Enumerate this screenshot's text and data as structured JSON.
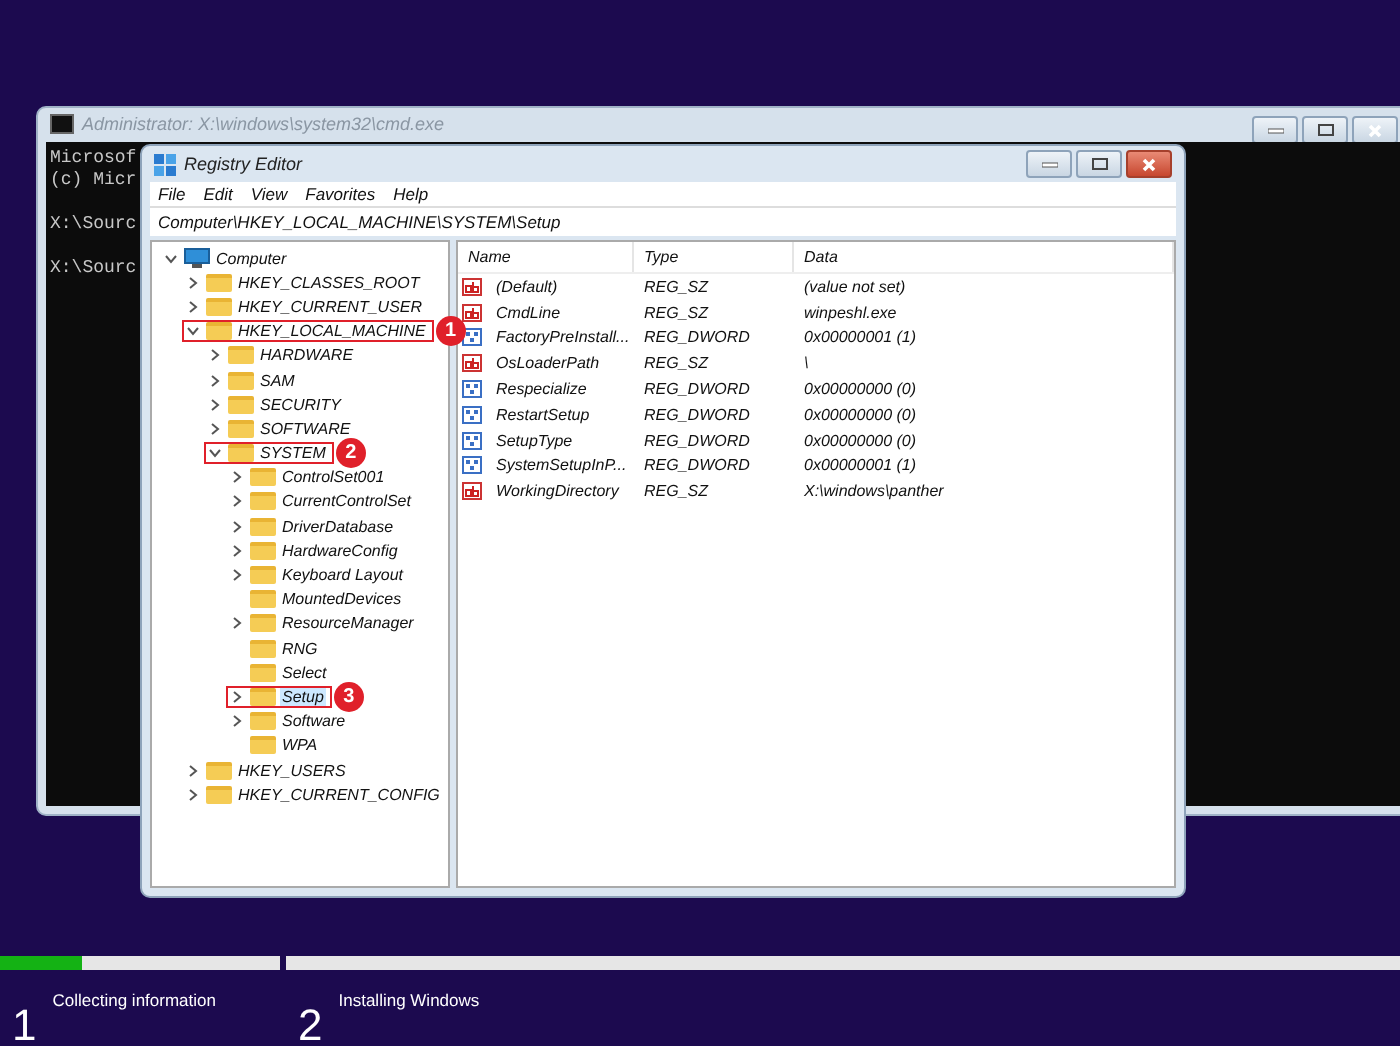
{
  "console": {
    "title": "Administrator: X:\\windows\\system32\\cmd.exe",
    "blocks": [
      [
        "Microsof",
        "(c) Micr"
      ],
      [
        "X:\\Sourc"
      ],
      [
        "X:\\Sourc"
      ]
    ]
  },
  "regedit": {
    "title": "Registry Editor",
    "menu": [
      "File",
      "Edit",
      "View",
      "Favorites",
      "Help"
    ],
    "address": "Computer\\HKEY_LOCAL_MACHINE\\SYSTEM\\Setup",
    "tree": [
      {
        "label": "Computer",
        "kind": "computer",
        "expanded": true,
        "selected": false,
        "children": [
          {
            "label": "HKEY_CLASSES_ROOT",
            "expanded": false,
            "selected": false
          },
          {
            "label": "HKEY_CURRENT_USER",
            "expanded": false,
            "selected": false
          },
          {
            "label": "HKEY_LOCAL_MACHINE",
            "expanded": true,
            "selected": false,
            "callout": "1",
            "children": [
              {
                "label": "HARDWARE",
                "expanded": false,
                "selected": false
              },
              {
                "label": "SAM",
                "expanded": false,
                "selected": false
              },
              {
                "label": "SECURITY",
                "expanded": false,
                "selected": false
              },
              {
                "label": "SOFTWARE",
                "expanded": false,
                "selected": false
              },
              {
                "label": "SYSTEM",
                "expanded": true,
                "selected": false,
                "callout": "2",
                "children": [
                  {
                    "label": "ControlSet001",
                    "expanded": false,
                    "selected": false
                  },
                  {
                    "label": "CurrentControlSet",
                    "expanded": false,
                    "selected": false
                  },
                  {
                    "label": "DriverDatabase",
                    "expanded": false,
                    "selected": false
                  },
                  {
                    "label": "HardwareConfig",
                    "expanded": false,
                    "selected": false
                  },
                  {
                    "label": "Keyboard Layout",
                    "expanded": false,
                    "selected": false
                  },
                  {
                    "label": "MountedDevices",
                    "selected": false
                  },
                  {
                    "label": "ResourceManager",
                    "expanded": false,
                    "selected": false
                  },
                  {
                    "label": "RNG",
                    "selected": false
                  },
                  {
                    "label": "Select",
                    "selected": false
                  },
                  {
                    "label": "Setup",
                    "expanded": false,
                    "selected": true,
                    "callout": "3"
                  },
                  {
                    "label": "Software",
                    "expanded": false,
                    "selected": false
                  },
                  {
                    "label": "WPA",
                    "selected": false
                  }
                ]
              }
            ]
          },
          {
            "label": "HKEY_USERS",
            "expanded": false,
            "selected": false
          },
          {
            "label": "HKEY_CURRENT_CONFIG",
            "expanded": false,
            "selected": false
          }
        ]
      }
    ],
    "columns": [
      "Name",
      "Type",
      "Data"
    ],
    "values": [
      {
        "kind": "string",
        "name": "(Default)",
        "type": "REG_SZ",
        "data": "(value not set)"
      },
      {
        "kind": "string",
        "name": "CmdLine",
        "type": "REG_SZ",
        "data": "winpeshl.exe"
      },
      {
        "kind": "dword",
        "name": "FactoryPreInstall...",
        "type": "REG_DWORD",
        "data": "0x00000001 (1)"
      },
      {
        "kind": "string",
        "name": "OsLoaderPath",
        "type": "REG_SZ",
        "data": "\\"
      },
      {
        "kind": "dword",
        "name": "Respecialize",
        "type": "REG_DWORD",
        "data": "0x00000000 (0)"
      },
      {
        "kind": "dword",
        "name": "RestartSetup",
        "type": "REG_DWORD",
        "data": "0x00000000 (0)"
      },
      {
        "kind": "dword",
        "name": "SetupType",
        "type": "REG_DWORD",
        "data": "0x00000000 (0)"
      },
      {
        "kind": "dword",
        "name": "SystemSetupInP...",
        "type": "REG_DWORD",
        "data": "0x00000001 (1)"
      },
      {
        "kind": "string",
        "name": "WorkingDirectory",
        "type": "REG_SZ",
        "data": "X:\\windows\\panther"
      }
    ]
  },
  "setup": {
    "steps": [
      {
        "number": "1",
        "label": "Collecting information",
        "level": 0.29
      },
      {
        "number": "2",
        "label": "Installing Windows"
      }
    ]
  }
}
